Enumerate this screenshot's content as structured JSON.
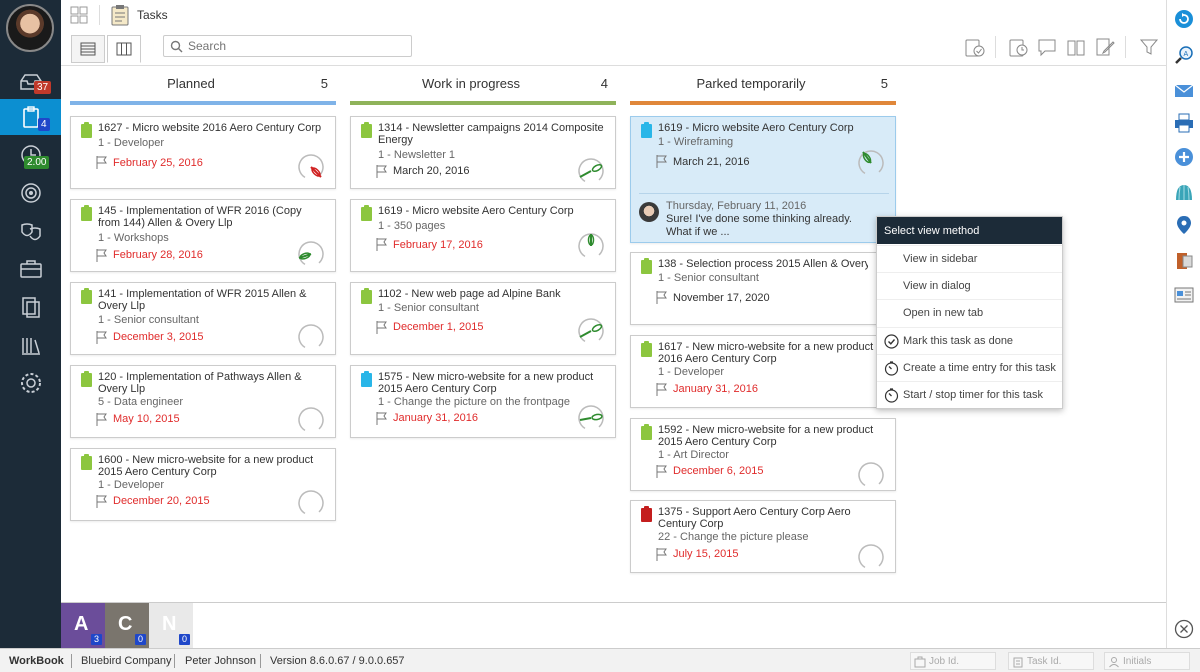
{
  "app": {
    "title": "Tasks",
    "search_placeholder": "Search"
  },
  "left_nav": {
    "badges": {
      "inbox": "37",
      "tasks": "4",
      "time": "2.00"
    }
  },
  "columns": [
    {
      "name": "Planned",
      "count": "5",
      "color": "#7fb3e8"
    },
    {
      "name": "Work in progress",
      "count": "4",
      "color": "#8fb35a"
    },
    {
      "name": "Parked temporarily",
      "count": "5",
      "color": "#e0873a"
    }
  ],
  "cards": {
    "planned": [
      {
        "title": "1627 - Micro website 2016 Aero Century Corp",
        "sub": "1 - Developer",
        "date": "February 25, 2016"
      },
      {
        "title": "145 - Implementation of WFR 2016 (Copy from 144) Allen & Overy Llp",
        "sub": "1 - Workshops",
        "date": "February 28, 2016"
      },
      {
        "title": "141 - Implementation of WFR 2015 Allen & Overy Llp",
        "sub": "1 - Senior consultant",
        "date": "December 3, 2015"
      },
      {
        "title": "120 - Implementation of Pathways Allen & Overy Llp",
        "sub": "5 - Data engineer",
        "date": "May 10, 2015"
      },
      {
        "title": "1600 - New micro-website for a new product 2015 Aero Century Corp",
        "sub": "1 - Developer",
        "date": "December 20, 2015"
      }
    ],
    "wip": [
      {
        "title": "1314 - Newsletter campaigns 2014 Composite Energy",
        "sub": "1 - Newsletter 1",
        "date": "March 20, 2016"
      },
      {
        "title": "1619 - Micro website Aero Century Corp",
        "sub": "1 - 350 pages",
        "date": "February 17, 2016"
      },
      {
        "title": "1102 - New web page ad Alpine Bank",
        "sub": "1 - Senior consultant",
        "date": "December 1, 2015"
      },
      {
        "title": "1575 - New micro-website for a new product 2015 Aero Century Corp",
        "sub": "1 - Change the picture on the frontpage",
        "date": "January 31, 2016"
      }
    ],
    "parked": [
      {
        "title": "1619 - Micro website Aero Century Corp",
        "sub": "1 - Wireframing",
        "date": "March 21, 2016",
        "comment_time": "Thursday, February 11, 2016",
        "comment_text": "Sure! I've done some thinking already. What if we ..."
      },
      {
        "title": "138 - Selection process 2015 Allen & Overy Llp",
        "sub": "1 - Senior consultant",
        "date": "November 17, 2020"
      },
      {
        "title": "1617 - New micro-website for a new product 2016 Aero Century Corp",
        "sub": "1 - Developer",
        "date": "January 31, 2016"
      },
      {
        "title": "1592 - New micro-website for a new product 2015 Aero Century Corp",
        "sub": "1 - Art Director",
        "date": "December 6, 2015"
      },
      {
        "title": "1375 - Support Aero Century Corp Aero Century Corp",
        "sub": "22 - Change the picture please",
        "date": "July 15, 2015"
      }
    ]
  },
  "context_menu": {
    "title": "Select view method",
    "items": [
      "View in sidebar",
      "View in dialog",
      "Open in new tab",
      "Mark this task as done",
      "Create a time entry for this task",
      "Start / stop timer for this task"
    ]
  },
  "users": [
    {
      "letter": "A",
      "count": "3",
      "color": "#6b4d9a"
    },
    {
      "letter": "C",
      "count": "0",
      "color": "#7a756d"
    },
    {
      "letter": "N",
      "count": "0",
      "color": "#e9e9e9"
    }
  ],
  "status_bar": {
    "app": "WorkBook",
    "company": "Bluebird Company",
    "user": "Peter Johnson",
    "version": "Version 8.6.0.67 / 9.0.0.657",
    "job_placeholder": "Job Id.",
    "task_placeholder": "Task Id.",
    "initials_placeholder": "Initials"
  }
}
